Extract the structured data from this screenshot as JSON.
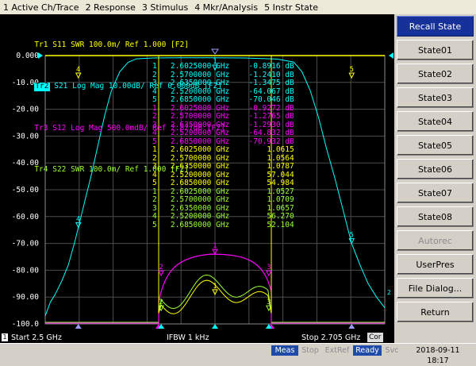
{
  "menu": [
    "1 Active Ch/Trace",
    "2 Response",
    "3 Stimulus",
    "4 Mkr/Analysis",
    "5 Instr State"
  ],
  "colors": {
    "tr1": "#ffff00",
    "tr2": "#00ffff",
    "tr3": "#ff00ff",
    "tr4": "#99ff33",
    "marker_tr1": "#ffff00",
    "marker_tr2": "#00ffff",
    "marker_tr3": "#ff00ff",
    "marker_tr4": "#99ff33",
    "accent": "#17319a"
  },
  "traces": [
    {
      "id": "Tr1",
      "param": "S11",
      "format": "SWR",
      "scale": "100.0m/",
      "ref": "Ref 1.000",
      "ch": "[F2]",
      "active": false
    },
    {
      "id": "Tr2",
      "param": "S21",
      "format": "Log Mag",
      "scale": "10.00dB/",
      "ref": "Ref 0.000dB",
      "ch": "[F2]",
      "active": true
    },
    {
      "id": "Tr3",
      "param": "S12",
      "format": "Log Mag",
      "scale": "500.0mdB/",
      "ref": "Ref 2.827dB",
      "ch": "[F2]",
      "active": false
    },
    {
      "id": "Tr4",
      "param": "S22",
      "format": "SWR",
      "scale": "100.0m/",
      "ref": "Ref 1.000",
      "ch": "[F2]",
      "active": false
    }
  ],
  "yaxis": {
    "labels": [
      "0.000",
      "-10.00",
      "-20.00",
      "-30.00",
      "-40.00",
      "-50.00",
      "-60.00",
      "-70.00",
      "-80.00",
      "-90.00",
      "-100.0"
    ]
  },
  "markers": {
    "tr2": [
      {
        "n": "1",
        "freq": "2.6025000 GHz",
        "val": "-0.8916 dB"
      },
      {
        "n": "2",
        "freq": "2.5700000 GHz",
        "val": "-1.2410 dB"
      },
      {
        "n": "3",
        "freq": "2.6350000 GHz",
        "val": "-1.3475 dB"
      },
      {
        "n": "4",
        "freq": "2.5200000 GHz",
        "val": "-64.067 dB"
      },
      {
        "n": "5",
        "freq": "2.6850000 GHz",
        "val": "-70.046 dB"
      }
    ],
    "tr3": [
      {
        "n": "1",
        "freq": "2.6025000 GHz",
        "val": "-0.9272 dB"
      },
      {
        "n": "2",
        "freq": "2.5700000 GHz",
        "val": "-1.2765 dB"
      },
      {
        "n": "3",
        "freq": "2.6350000 GHz",
        "val": "-1.2930 dB"
      },
      {
        "n": "4",
        "freq": "2.5200000 GHz",
        "val": "-64.832 dB"
      },
      {
        "n": "5",
        "freq": "2.6850000 GHz",
        "val": "-70.932 dB"
      }
    ],
    "tr1": [
      {
        "n": "1",
        "freq": "2.6025000 GHz",
        "val": "1.0615"
      },
      {
        "n": "2",
        "freq": "2.5700000 GHz",
        "val": "1.0564"
      },
      {
        "n": "3",
        "freq": "2.6350000 GHz",
        "val": "1.0787"
      },
      {
        "n": "4",
        "freq": "2.5200000 GHz",
        "val": "57.044"
      },
      {
        "n": "5",
        "freq": "2.6850000 GHz",
        "val": "54.984"
      }
    ],
    "tr4": [
      {
        "n": "1",
        "freq": "2.6025000 GHz",
        "val": "1.0527"
      },
      {
        "n": "2",
        "freq": "2.5700000 GHz",
        "val": "1.0709"
      },
      {
        "n": "3",
        "freq": "2.6350000 GHz",
        "val": "1.0657"
      },
      {
        "n": "4",
        "freq": "2.5200000 GHz",
        "val": "56.270"
      },
      {
        "n": "5",
        "freq": "2.6850000 GHz",
        "val": "52.104"
      }
    ]
  },
  "stimulus": {
    "channel": "1",
    "start": "Start 2.5 GHz",
    "ifbw": "IFBW 1 kHz",
    "stop": "Stop 2.705 GHz",
    "cor": "Cor"
  },
  "softkeys": {
    "title": "Recall State",
    "items": [
      {
        "label": "State01",
        "enabled": true
      },
      {
        "label": "State02",
        "enabled": true
      },
      {
        "label": "State03",
        "enabled": true
      },
      {
        "label": "State04",
        "enabled": true
      },
      {
        "label": "State05",
        "enabled": true
      },
      {
        "label": "State06",
        "enabled": true
      },
      {
        "label": "State07",
        "enabled": true
      },
      {
        "label": "State08",
        "enabled": true
      },
      {
        "label": "Autorec",
        "enabled": false
      },
      {
        "label": "UserPres",
        "enabled": true
      },
      {
        "label": "File Dialog...",
        "enabled": true
      },
      {
        "label": "Return",
        "enabled": true
      }
    ]
  },
  "status": {
    "meas": "Meas",
    "stop": "Stop",
    "extref": "ExtRef",
    "ready": "Ready",
    "svc": "Svc",
    "datetime": "2018-09-11 18:17"
  }
}
